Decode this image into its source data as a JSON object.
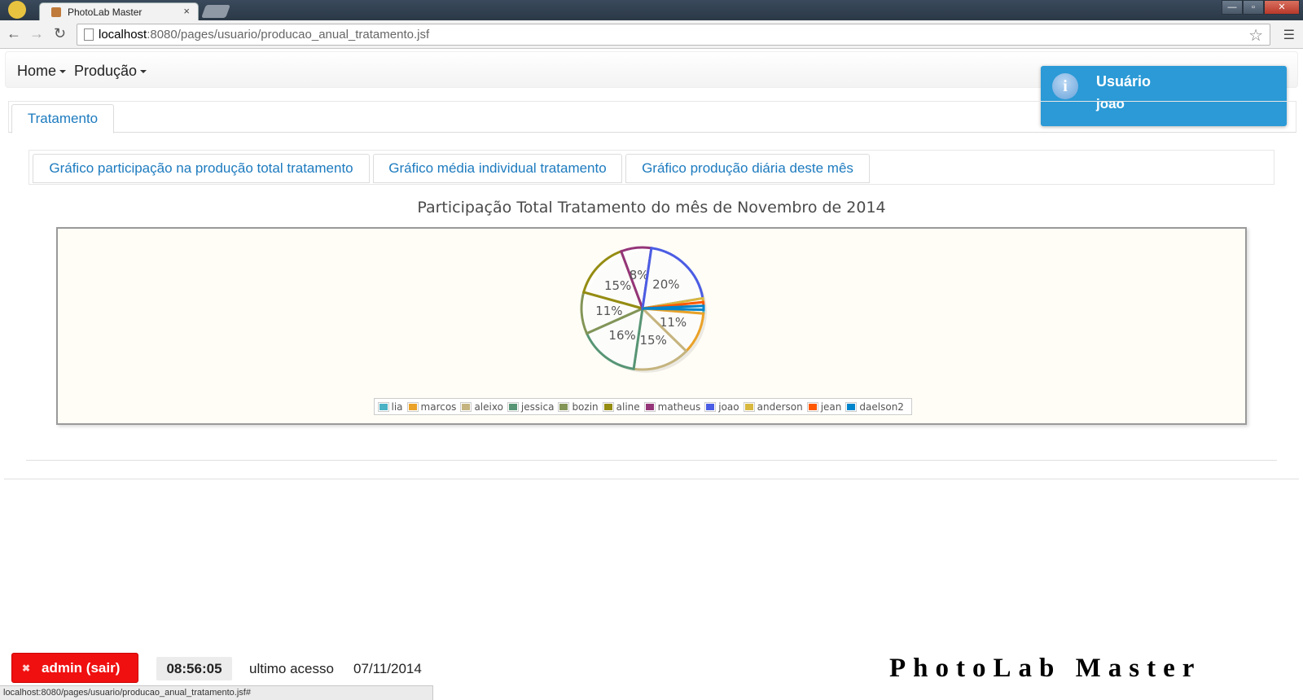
{
  "browser": {
    "tab_title": "PhotoLab Master",
    "tab_close": "×",
    "url_host": "localhost",
    "url_rest": ":8080/pages/usuario/producao_anual_tratamento.jsf",
    "star": "☆",
    "menu": "☰",
    "back": "←",
    "forward": "→",
    "reload": "↻",
    "win_min": "—",
    "win_max": "▫",
    "win_close": "✕"
  },
  "navbar": {
    "home": "Home",
    "producao": "Produção"
  },
  "growl": {
    "icon": "i",
    "title": "Usuário",
    "message": "joao"
  },
  "outer_tab": "Tratamento",
  "inner_tabs": [
    "Gráfico participação na produção total tratamento",
    "Gráfico média individual tratamento",
    "Gráfico produção diária deste mês"
  ],
  "chart_data": {
    "type": "pie",
    "title": "Participação Total Tratamento do mês de Novembro de 2014",
    "legend_position": "bottom",
    "slices": [
      {
        "name": "lia",
        "value": 1,
        "label": "",
        "color": "#4bb2c5"
      },
      {
        "name": "marcos",
        "value": 11,
        "label": "11%",
        "color": "#eaa228"
      },
      {
        "name": "aleixo",
        "value": 15,
        "label": "15%",
        "color": "#c5b47f"
      },
      {
        "name": "jessica",
        "value": 16,
        "label": "16%",
        "color": "#579575"
      },
      {
        "name": "bozin",
        "value": 11,
        "label": "11%",
        "color": "#839557"
      },
      {
        "name": "aline",
        "value": 15,
        "label": "15%",
        "color": "#958c12"
      },
      {
        "name": "matheus",
        "value": 8,
        "label": "8%",
        "color": "#953579"
      },
      {
        "name": "joao",
        "value": 20,
        "label": "20%",
        "color": "#4b5de4"
      },
      {
        "name": "anderson",
        "value": 1,
        "label": "",
        "color": "#d8b83f"
      },
      {
        "name": "jean",
        "value": 1,
        "label": "",
        "color": "#ff5800"
      },
      {
        "name": "daelson2",
        "value": 1,
        "label": "",
        "color": "#0085cc"
      }
    ]
  },
  "footer": {
    "logout_icon": "✖",
    "logout": "admin (sair)",
    "clock": "08:56:05",
    "last_access_label": "ultimo acesso",
    "last_access_date": "07/11/2014",
    "brand": "PhotoLab Master"
  },
  "status_url": "localhost:8080/pages/usuario/producao_anual_tratamento.jsf#"
}
